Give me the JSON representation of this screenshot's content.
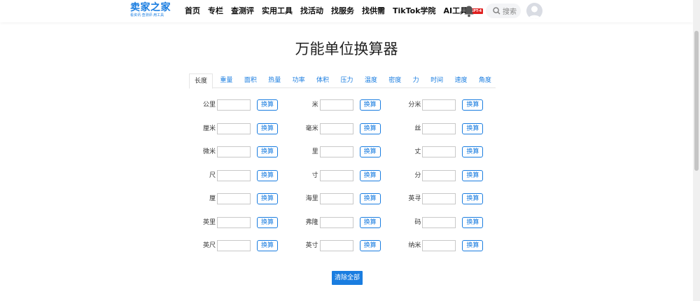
{
  "header": {
    "logo_main": "卖家之家",
    "logo_sub": "看资讯·查测评·用工具",
    "nav": [
      "首页",
      "专栏",
      "查测评",
      "实用工具",
      "找活动",
      "找服务",
      "找供需",
      "TikTok学院"
    ],
    "ai_label": "AI工具",
    "ai_badge": "GPT-4",
    "search_label": "搜索"
  },
  "page": {
    "title": "万能单位换算器",
    "tabs": [
      "长度",
      "重量",
      "面积",
      "热量",
      "功率",
      "体积",
      "压力",
      "温度",
      "密度",
      "力",
      "时间",
      "速度",
      "角度"
    ],
    "active_tab": 0,
    "units": [
      [
        "公里",
        "米",
        "分米"
      ],
      [
        "厘米",
        "毫米",
        "丝"
      ],
      [
        "微米",
        "里",
        "丈"
      ],
      [
        "尺",
        "寸",
        "分"
      ],
      [
        "厘",
        "海里",
        "英寻"
      ],
      [
        "英里",
        "弗隆",
        "码"
      ],
      [
        "英尺",
        "英寸",
        "纳米"
      ]
    ],
    "convert_label": "换算",
    "clear_label": "清除全部"
  },
  "colors": {
    "accent": "#1a7de0",
    "badge": "#e02020"
  }
}
